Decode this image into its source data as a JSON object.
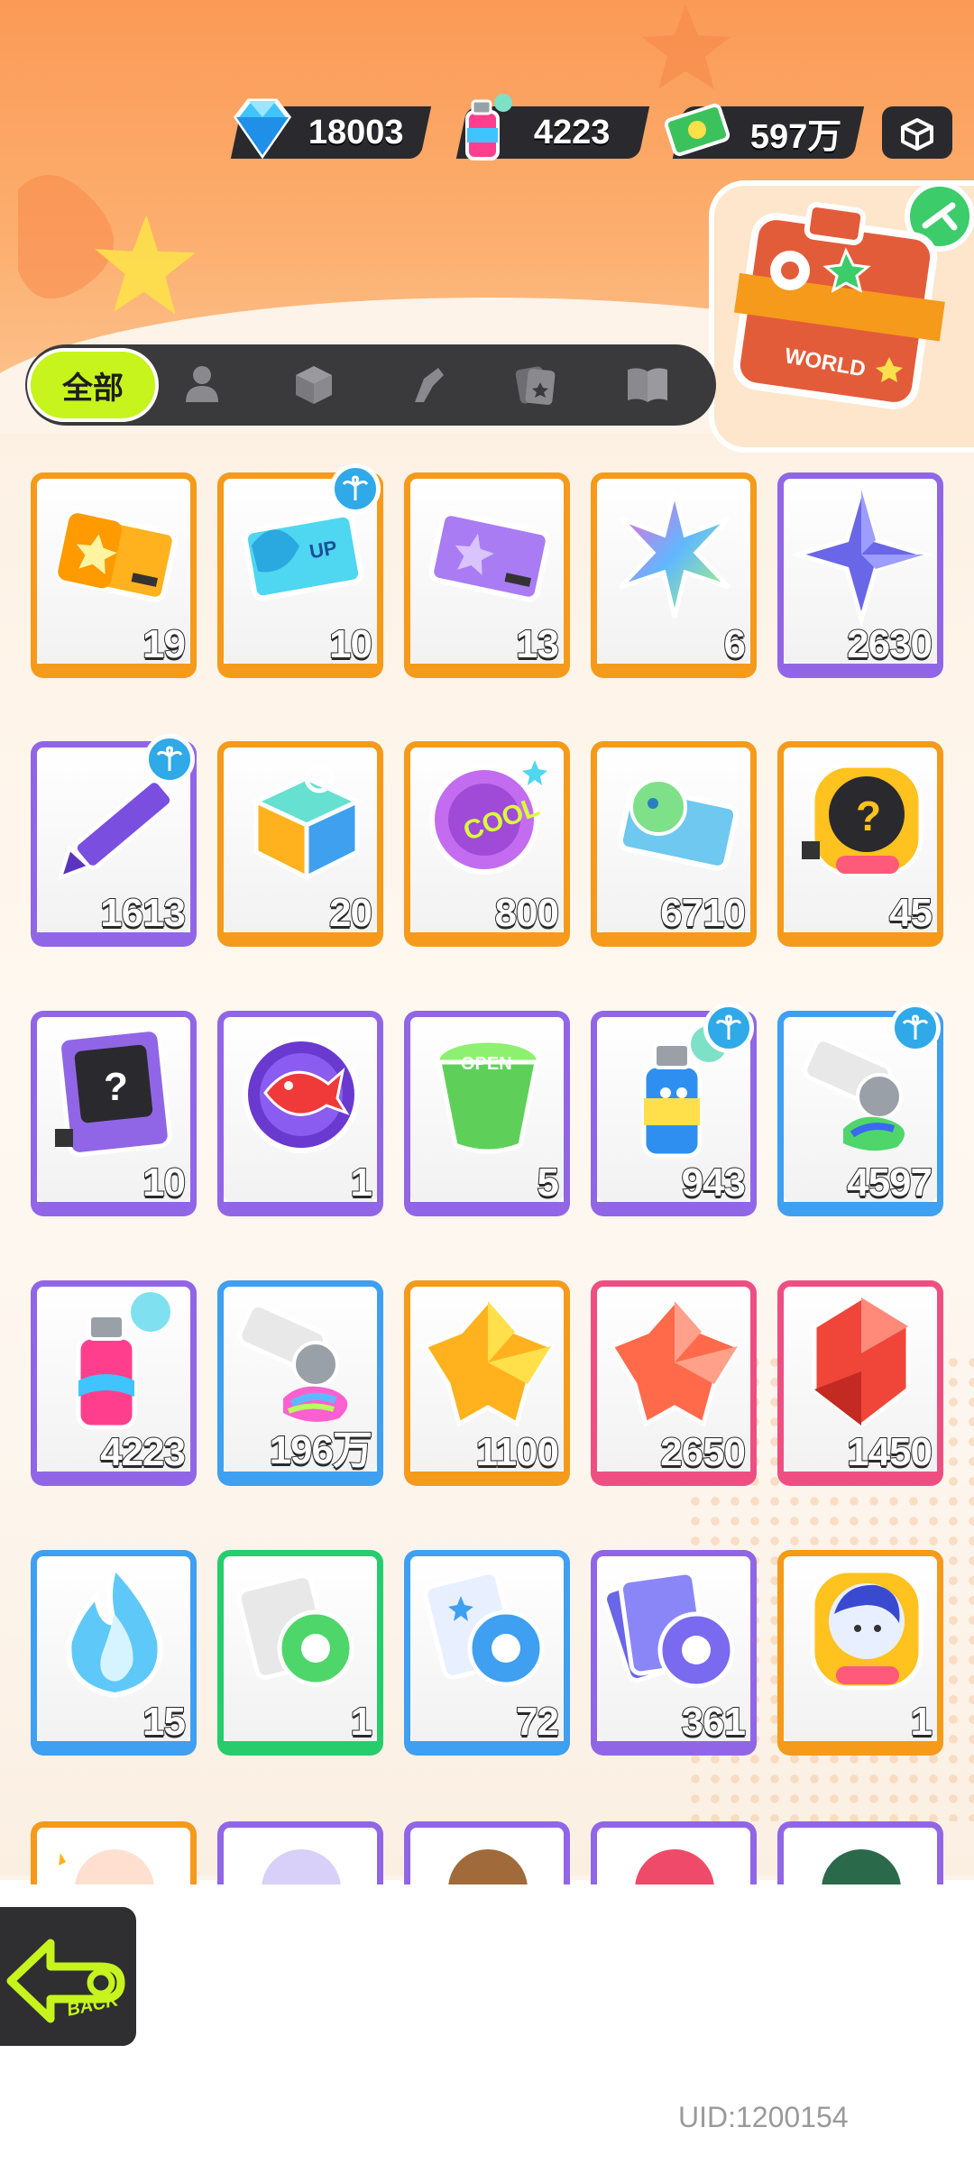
{
  "currencies": [
    {
      "name": "diamond",
      "value": "18003",
      "icon": "diamond-icon"
    },
    {
      "name": "spray",
      "value": "4223",
      "icon": "spray-can-icon"
    },
    {
      "name": "cash",
      "value": "597万",
      "icon": "cash-icon"
    }
  ],
  "tabs": {
    "active_label": "全部",
    "icons": [
      "person-icon",
      "box-icon",
      "tool-icon",
      "cards-icon",
      "book-icon"
    ]
  },
  "travel": {
    "label": "WORLD"
  },
  "items": [
    {
      "name": "gold-ticket",
      "qty": "19",
      "color": "orange"
    },
    {
      "name": "up-ticket",
      "qty": "10",
      "color": "orange",
      "badge": true
    },
    {
      "name": "purple-ticket",
      "qty": "13",
      "color": "orange"
    },
    {
      "name": "rainbow-star",
      "qty": "6",
      "color": "orange"
    },
    {
      "name": "purple-star",
      "qty": "2630",
      "color": "purple"
    },
    {
      "name": "crayon",
      "qty": "1613",
      "color": "purple",
      "badge": true
    },
    {
      "name": "color-box",
      "qty": "20",
      "color": "orange"
    },
    {
      "name": "cool-badge",
      "qty": "800",
      "color": "orange"
    },
    {
      "name": "season-ticket",
      "qty": "6710",
      "color": "orange"
    },
    {
      "name": "deity-mystery-coin",
      "qty": "45",
      "color": "orange"
    },
    {
      "name": "travel-card",
      "qty": "10",
      "color": "purple"
    },
    {
      "name": "mpety-orb",
      "qty": "1",
      "color": "purple"
    },
    {
      "name": "open-cup",
      "qty": "5",
      "color": "purple"
    },
    {
      "name": "blue-spray",
      "qty": "943",
      "color": "purple",
      "badge": true
    },
    {
      "name": "paint-tube",
      "qty": "4597",
      "color": "blue",
      "badge": true
    },
    {
      "name": "pink-spray",
      "qty": "4223",
      "color": "purple"
    },
    {
      "name": "rainbow-tube",
      "qty": "196万",
      "color": "blue"
    },
    {
      "name": "gold-crystal",
      "qty": "1100",
      "color": "orange"
    },
    {
      "name": "coral-crystal",
      "qty": "2650",
      "color": "pink"
    },
    {
      "name": "red-gem",
      "qty": "1450",
      "color": "pink"
    },
    {
      "name": "blue-flame",
      "qty": "15",
      "color": "blue"
    },
    {
      "name": "green-tape",
      "qty": "1",
      "color": "green"
    },
    {
      "name": "blue-tape",
      "qty": "72",
      "color": "blue"
    },
    {
      "name": "purple-tape",
      "qty": "361",
      "color": "purple"
    },
    {
      "name": "deity-avatar",
      "qty": "1",
      "color": "orange"
    }
  ],
  "partial_row_colors": [
    "orange",
    "purple",
    "purple",
    "purple",
    "purple"
  ],
  "back": {
    "label": "BACK"
  },
  "uid": "UID:1200154",
  "colors": {
    "accent": "#c6f41c",
    "dark": "#2a2a2e",
    "orange": "#f59a1b",
    "purple": "#9166e6",
    "blue": "#3f9ff0",
    "pink": "#ee4f83",
    "green": "#27cc6c"
  }
}
